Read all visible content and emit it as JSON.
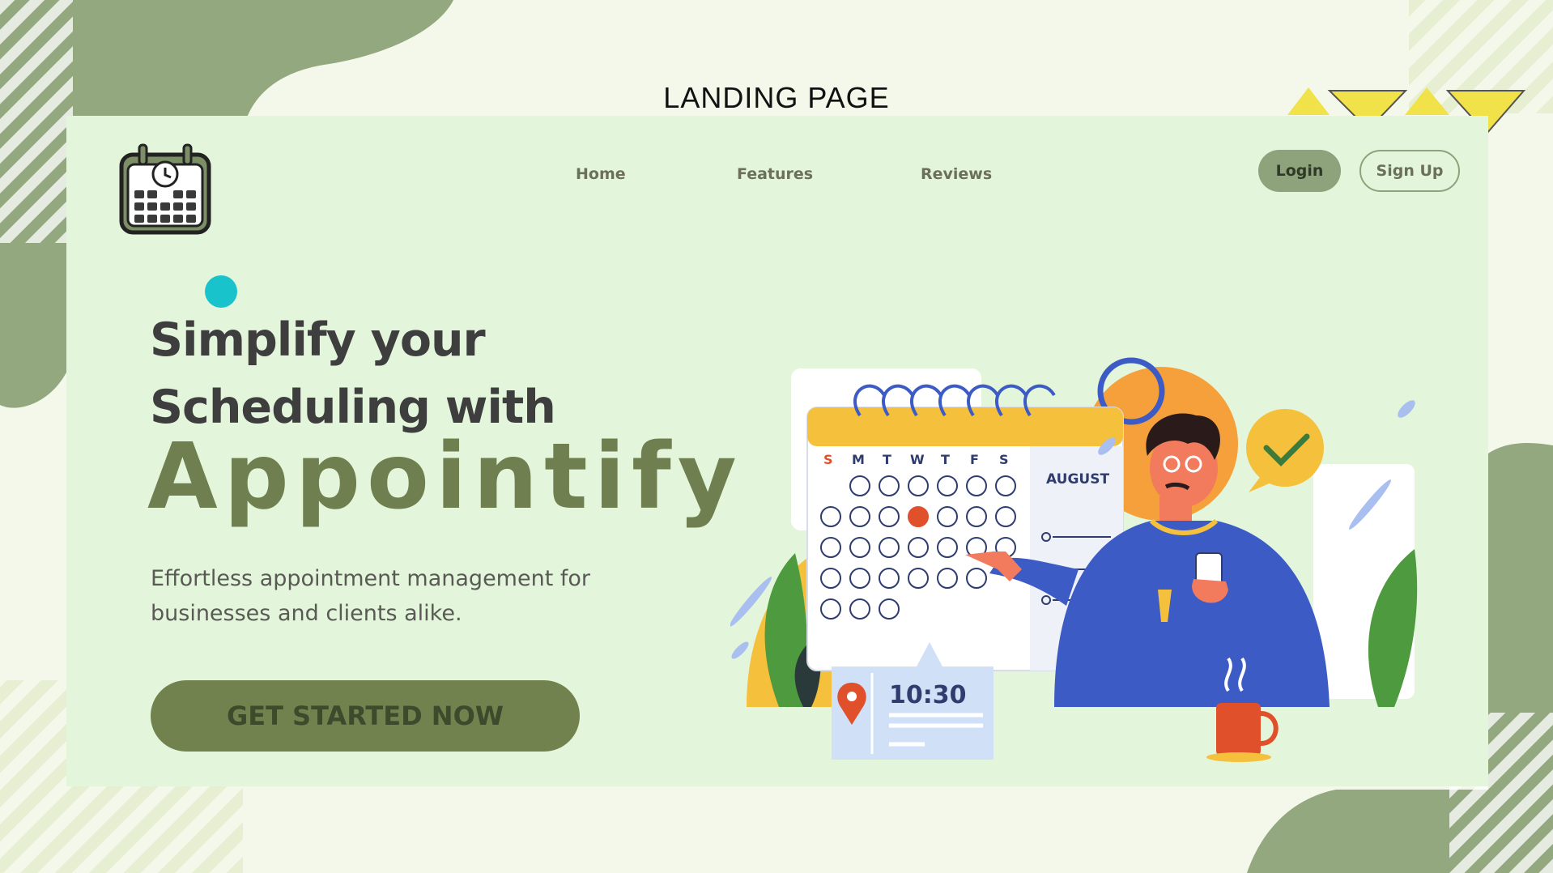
{
  "slide": {
    "title": "LANDING PAGE"
  },
  "header": {
    "nav": [
      {
        "label": "Home"
      },
      {
        "label": "Features"
      },
      {
        "label": "Reviews"
      }
    ],
    "login_label": "Login",
    "signup_label": "Sign Up"
  },
  "hero": {
    "headline_line1": "Simplify your",
    "headline_line2": "Scheduling with",
    "brand": "Appointify",
    "subtitle_line1": "Effortless appointment management for",
    "subtitle_line2": "businesses and clients alike.",
    "cta_label": "GET STARTED NOW"
  },
  "illustration": {
    "weekdays": [
      "S",
      "M",
      "T",
      "W",
      "T",
      "F",
      "S"
    ],
    "month": "AUGUST",
    "time": "10:30"
  },
  "colors": {
    "card_bg": "#e3f6db",
    "accent_green": "#72824f",
    "blob_green": "#93a87f",
    "highlight_dot": "#18c3cc"
  }
}
